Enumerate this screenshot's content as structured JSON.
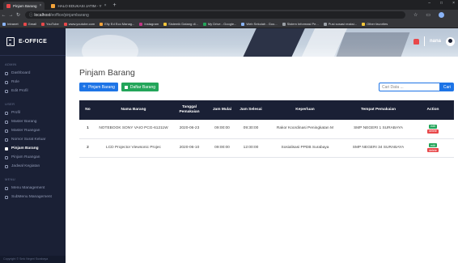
{
  "browser": {
    "tabs": [
      {
        "title": "Pinjam Barang"
      },
      {
        "title": "HALO EDUKASI JATIM - Y"
      }
    ],
    "url_host": "localhost",
    "url_path": "/eoffice/pinjambarang",
    "bookmarks": [
      "Intranet",
      "Gmail",
      "YouTube",
      "www.youtube.com",
      "Elly Ed Eco Manag...",
      "Instagram",
      "Sistemik Datang di...",
      "My Drive - Google...",
      "Web Sekolah - Goo...",
      "Sistem Informasi Pe...",
      "Pusi sosasi reaksi..."
    ],
    "other_bookmarks": "Other favorites"
  },
  "sidebar": {
    "brand": "E-OFFICE",
    "sections": [
      {
        "heading": "ADMIN",
        "items": [
          {
            "label": "Dashboard"
          },
          {
            "label": "Role"
          },
          {
            "label": "Edit Profil"
          }
        ]
      },
      {
        "heading": "USER",
        "items": [
          {
            "label": "Profil"
          },
          {
            "label": "Master Barang"
          },
          {
            "label": "Master Ruangan"
          },
          {
            "label": "Nomor Surat Keluar"
          },
          {
            "label": "Pinjam Barang",
            "active": true
          },
          {
            "label": "Pinjam Ruangan"
          },
          {
            "label": "Jadwal Kegiatan"
          }
        ]
      },
      {
        "heading": "MENU",
        "items": [
          {
            "label": "Menu Management"
          },
          {
            "label": "SubMenu Management"
          }
        ]
      }
    ],
    "footer": "Copyright © Smk Negeri Surabaya"
  },
  "header": {
    "username": "nana"
  },
  "main": {
    "title": "Pinjam Barang",
    "add_button": "Pinjam Barang",
    "list_button": "Daftar Barang",
    "search_placeholder": "Cari Data ...",
    "search_button": "Cari"
  },
  "table": {
    "columns": [
      "No",
      "Nama Barang",
      "Tanggal Pemakaian",
      "Jam Mulai",
      "Jam Selesai",
      "Keperluan",
      "Tempat Pemakaian",
      "Action"
    ],
    "rows": [
      {
        "no": "1",
        "nama": "NOTEBOOK SONY VAIO PCG-61211W",
        "tanggal": "2020-06-23",
        "mulai": "09:00:00",
        "selesai": "09:30:00",
        "keperluan": "Rakor Koordinasi Peningkatan M",
        "tempat": "SMP NEGERI 1 SURABAYA",
        "edit": "edit",
        "delete": "delete"
      },
      {
        "no": "2",
        "nama": "LCD Projector Viewsonic Projec",
        "tanggal": "2020-06-10",
        "mulai": "09:00:00",
        "selesai": "12:00:00",
        "keperluan": "Sosialisasi PPDB Surabaya",
        "tempat": "SMP NEGERI 34 SURABAYA",
        "edit": "edit",
        "delete": "delete"
      }
    ]
  },
  "colors": {
    "sidebar_bg": "#1a2035",
    "primary": "#1d74e6",
    "success": "#23a55a",
    "danger": "#e8484a"
  }
}
